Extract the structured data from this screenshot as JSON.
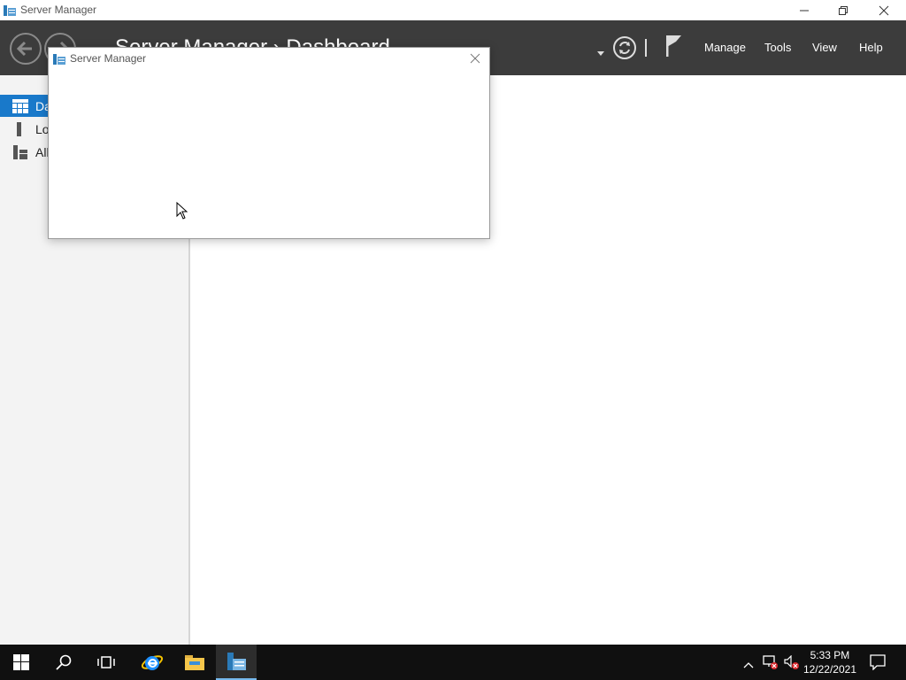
{
  "window": {
    "title": "Server Manager",
    "controls": [
      "minimize-icon",
      "restore-icon",
      "close-icon"
    ]
  },
  "header": {
    "breadcrumb": "Server Manager › Dashboard",
    "menus": [
      {
        "label": "Manage"
      },
      {
        "label": "Tools"
      },
      {
        "label": "View"
      },
      {
        "label": "Help"
      }
    ],
    "colors": {
      "background": "#3c3c3c",
      "text": "#ffffff"
    }
  },
  "sidebar": {
    "items": [
      {
        "label": "Dashboard",
        "visible_label": "Da",
        "icon": "dashboard-grid-icon",
        "selected": true
      },
      {
        "label": "Local Server",
        "visible_label": "Lo",
        "icon": "local-server-icon",
        "selected": false
      },
      {
        "label": "All Servers",
        "visible_label": "All",
        "icon": "all-servers-icon",
        "selected": false
      }
    ],
    "accent": "#1979ca"
  },
  "dialog": {
    "title": "Server Manager"
  },
  "taskbar": {
    "apps": [
      "start-icon",
      "search-icon",
      "task-view-icon",
      "internet-explorer-icon",
      "file-explorer-icon",
      "server-manager-icon"
    ],
    "active_app": "server-manager-icon",
    "clock": {
      "time": "5:33 PM",
      "date": "12/22/2021"
    },
    "tray": [
      "show-hidden-icons-icon",
      "network-error-icon",
      "volume-muted-icon",
      "notifications-icon"
    ]
  }
}
